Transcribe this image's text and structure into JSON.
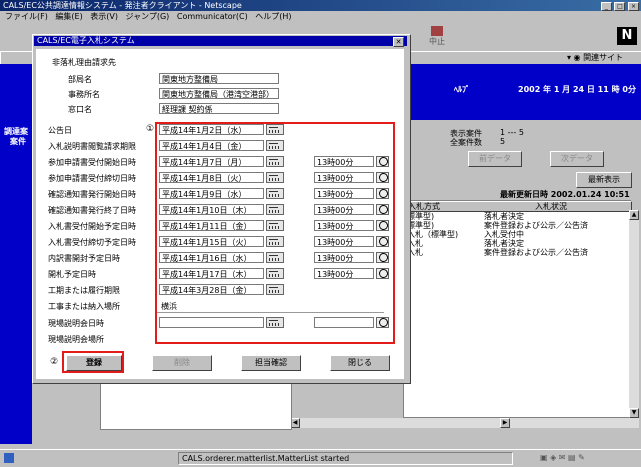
{
  "window": {
    "title": "CALS/EC公共調達情報システム - 発注者クライアント - Netscape"
  },
  "menu": [
    "ファイル(F)",
    "編集(E)",
    "表示(V)",
    "ジャンプ(G)",
    "Communicator(C)",
    "ヘルプ(H)"
  ],
  "toolbar": {
    "stop_label": "中止",
    "help_site": "関連サイト"
  },
  "left_panel": {
    "line1": "調達案",
    "line2": "案件"
  },
  "header": {
    "help": "ﾍﾙﾌﾟ",
    "datetime": "2002 年 1 月 24 日 11 時 0分"
  },
  "summary": {
    "display_label": "表示案件",
    "display_value": "1 --- 5",
    "total_label": "全案件数",
    "total_value": "5"
  },
  "nav": {
    "prev": "前データ",
    "next": "次データ",
    "latest": "最新表示",
    "updated": "最新更新日時 2002.01.24 10:51"
  },
  "table": {
    "col1": "入札方式",
    "col2": "入札状況",
    "rows": [
      {
        "method": "標準型)",
        "status": "落札者決定"
      },
      {
        "method": "標準型)",
        "status": "案件登録および公示／公告済"
      },
      {
        "method": "入札（標準型)",
        "status": "入札受付中"
      },
      {
        "method": "入札",
        "status": "落札者決定"
      },
      {
        "method": "入札",
        "status": "案件登録および公示／公告済"
      }
    ]
  },
  "dialog": {
    "title": "CALS/EC電子入札システム",
    "section": "非落札理由請求先",
    "dept_label": "部局名",
    "dept_value": "関東地方整備局",
    "office_label": "事務所名",
    "office_value": "関東地方整備局（港湾空港部）",
    "window_label": "窓口名",
    "window_value": "経理課 契約係",
    "marker1": "①",
    "marker2": "②",
    "dates": [
      {
        "label": "公告日",
        "date": "平成14年1月2日（水）",
        "time": ""
      },
      {
        "label": "入札説明書閲覧請求期限",
        "date": "平成14年1月4日（金）",
        "time": ""
      },
      {
        "label": "参加申請書受付開始日時",
        "date": "平成14年1月7日（月）",
        "time": "13時00分"
      },
      {
        "label": "参加申請書受付締切日時",
        "date": "平成14年1月8日（火）",
        "time": "13時00分"
      },
      {
        "label": "確認通知書発行開始日時",
        "date": "平成14年1月9日（水）",
        "time": "13時00分"
      },
      {
        "label": "確認通知書発行終了日時",
        "date": "平成14年1月10日（木）",
        "time": "13時00分"
      },
      {
        "label": "入札書受付開始予定日時",
        "date": "平成14年1月11日（金）",
        "time": "13時00分"
      },
      {
        "label": "入札書受付締切予定日時",
        "date": "平成14年1月15日（火）",
        "time": "13時00分"
      },
      {
        "label": "内訳書開封予定日時",
        "date": "平成14年1月16日（水）",
        "time": "13時00分"
      },
      {
        "label": "開札予定日時",
        "date": "平成14年1月17日（木）",
        "time": "13時00分"
      },
      {
        "label": "工期または履行期限",
        "date": "平成14年3月28日（金）",
        "time": ""
      }
    ],
    "place_label": "工事または納入場所",
    "place_value": "横浜",
    "briefing_label": "現場説明会日時",
    "briefing_place_label": "現場説明会場所",
    "buttons": {
      "register": "登録",
      "delete": "削除",
      "confirm": "担当確認",
      "close": "閉じる"
    }
  },
  "status": {
    "text": "CALS.orderer.matterlist.MatterList started"
  },
  "colors": {
    "highlight": "#e41b1b",
    "title_bar": "#0000a8",
    "panel_blue": "#0000c8"
  }
}
